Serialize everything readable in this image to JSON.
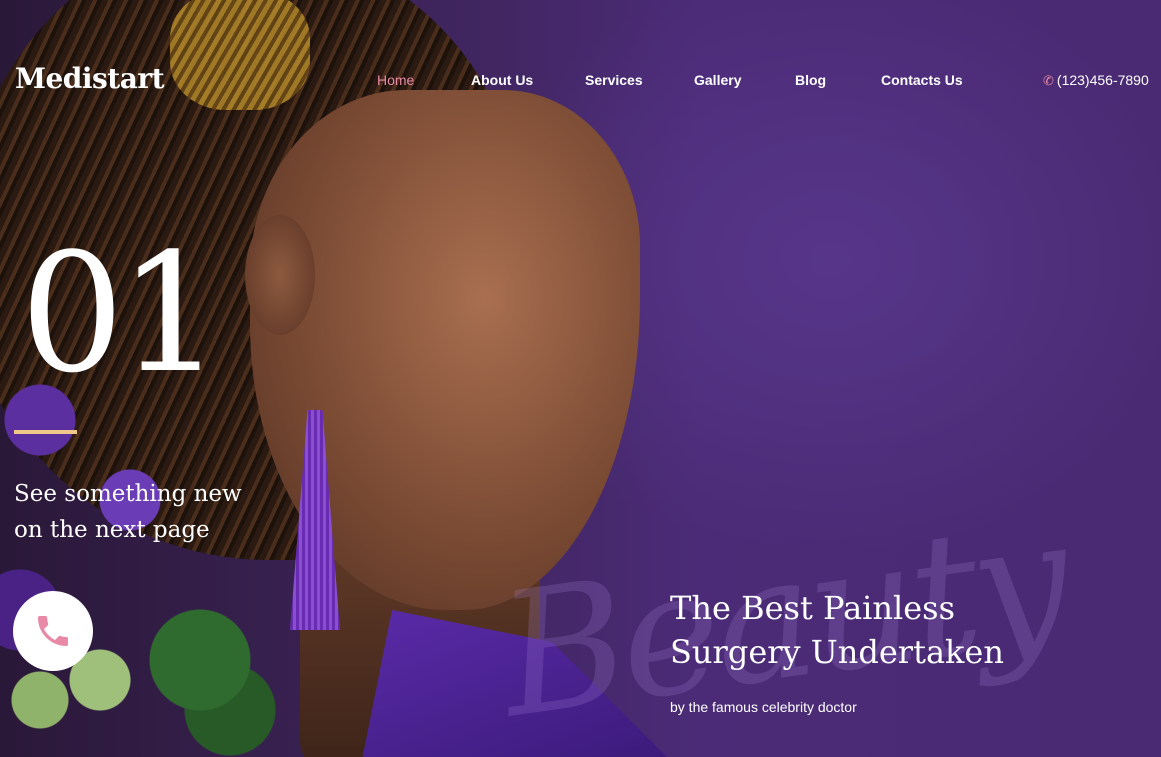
{
  "brand": {
    "logo": "Medistart"
  },
  "nav": {
    "items": [
      {
        "label": "Home",
        "active": true
      },
      {
        "label": "About Us",
        "active": false
      },
      {
        "label": "Services",
        "active": false
      },
      {
        "label": "Gallery",
        "active": false
      },
      {
        "label": "Blog",
        "active": false
      },
      {
        "label": "Contacts Us",
        "active": false
      }
    ],
    "phone": "(123)456-7890",
    "phone_icon": "phone-icon"
  },
  "slide": {
    "number": "01",
    "caption_line1": "See something new",
    "caption_line2": "on the next page",
    "call_icon": "phone-icon"
  },
  "hero": {
    "script_text": "Beauty",
    "headline_line1": "The Best Painless",
    "headline_line2": "Surgery Undertaken",
    "subtitle": "by the famous celebrity doctor"
  },
  "colors": {
    "accent_pink": "#e88aa6",
    "accent_gold": "#f0c78a",
    "background_purple": "#4a2a72"
  }
}
